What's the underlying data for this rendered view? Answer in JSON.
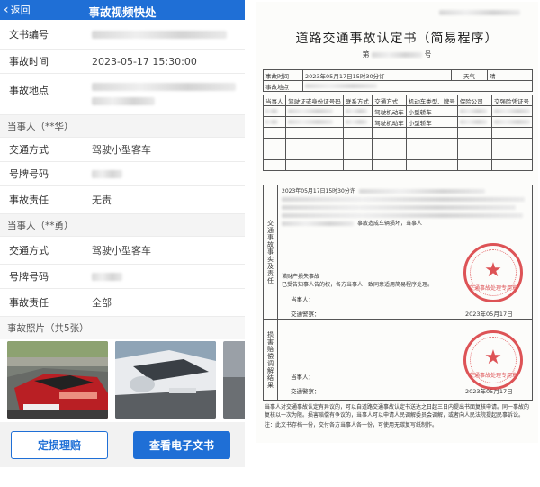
{
  "app": {
    "nav_title": "事故视频快处",
    "back_label": "返回"
  },
  "info": {
    "doc_no_label": "文书编号",
    "time_label": "事故时间",
    "time_value": "2023-05-17 15:30:00",
    "place_label": "事故地点"
  },
  "party1": {
    "header": "当事人（**华）",
    "transport_label": "交通方式",
    "transport_value": "驾驶小型客车",
    "plate_label": "号牌号码",
    "duty_label": "事故责任",
    "duty_value": "无责"
  },
  "party2": {
    "header": "当事人（**勇）",
    "transport_label": "交通方式",
    "transport_value": "驾驶小型客车",
    "plate_label": "号牌号码",
    "duty_label": "事故责任",
    "duty_value": "全部"
  },
  "photos": {
    "header": "事故照片（共5张）"
  },
  "actions": {
    "assess_label": "定损理赔",
    "view_doc_label": "查看电子文书"
  },
  "doc": {
    "title": "道路交通事故认定书（简易程序）",
    "no_prefix": "第",
    "no_suffix": "号",
    "time_label": "事故时间",
    "time_value": "2023年05月17日15时30分许",
    "weather_label": "天气",
    "weather_value": "晴",
    "place_label": "事故地点",
    "headers": [
      "当事人",
      "驾驶证或身份证号码",
      "联系方式",
      "交通方式",
      "机动车类型、牌号",
      "保险公司",
      "交强险凭证号"
    ],
    "row1_transport": "驾驶机动车",
    "row1_vehicle": "小型轿车",
    "row2_transport": "驾驶机动车",
    "row2_vehicle": "小型轿车",
    "side_label_1": "交通事故事实及责任",
    "side_label_2": "损害赔偿调解结果",
    "narr_first": "2023年05月17日15时30分许",
    "narr_second": "事故造成车辆损坏，当事人",
    "damage_text": "诺财产损失事故",
    "consent_text": "已受告知事人告的权，各方当事人一致同意适用简易程序处理。",
    "party_sign": "当事人：",
    "officer_sign": "交通警察：",
    "date_sign": "2023年05月17日",
    "stamp_text": "交通事故处理专用章",
    "footer_1": "当事人对交通事故认定有异议的，可以自道路交通事故认定书送达之日起三日内提出书面复核申请。同一事故的复核以一次为限。损害赔偿有争议的，当事人可以申请人民调解委员会调解，或者向人民法院提起民事诉讼。",
    "footer_2": "注：此文书存档一份，交付各方当事人各一份，可使用无碳复写纸制作。"
  }
}
